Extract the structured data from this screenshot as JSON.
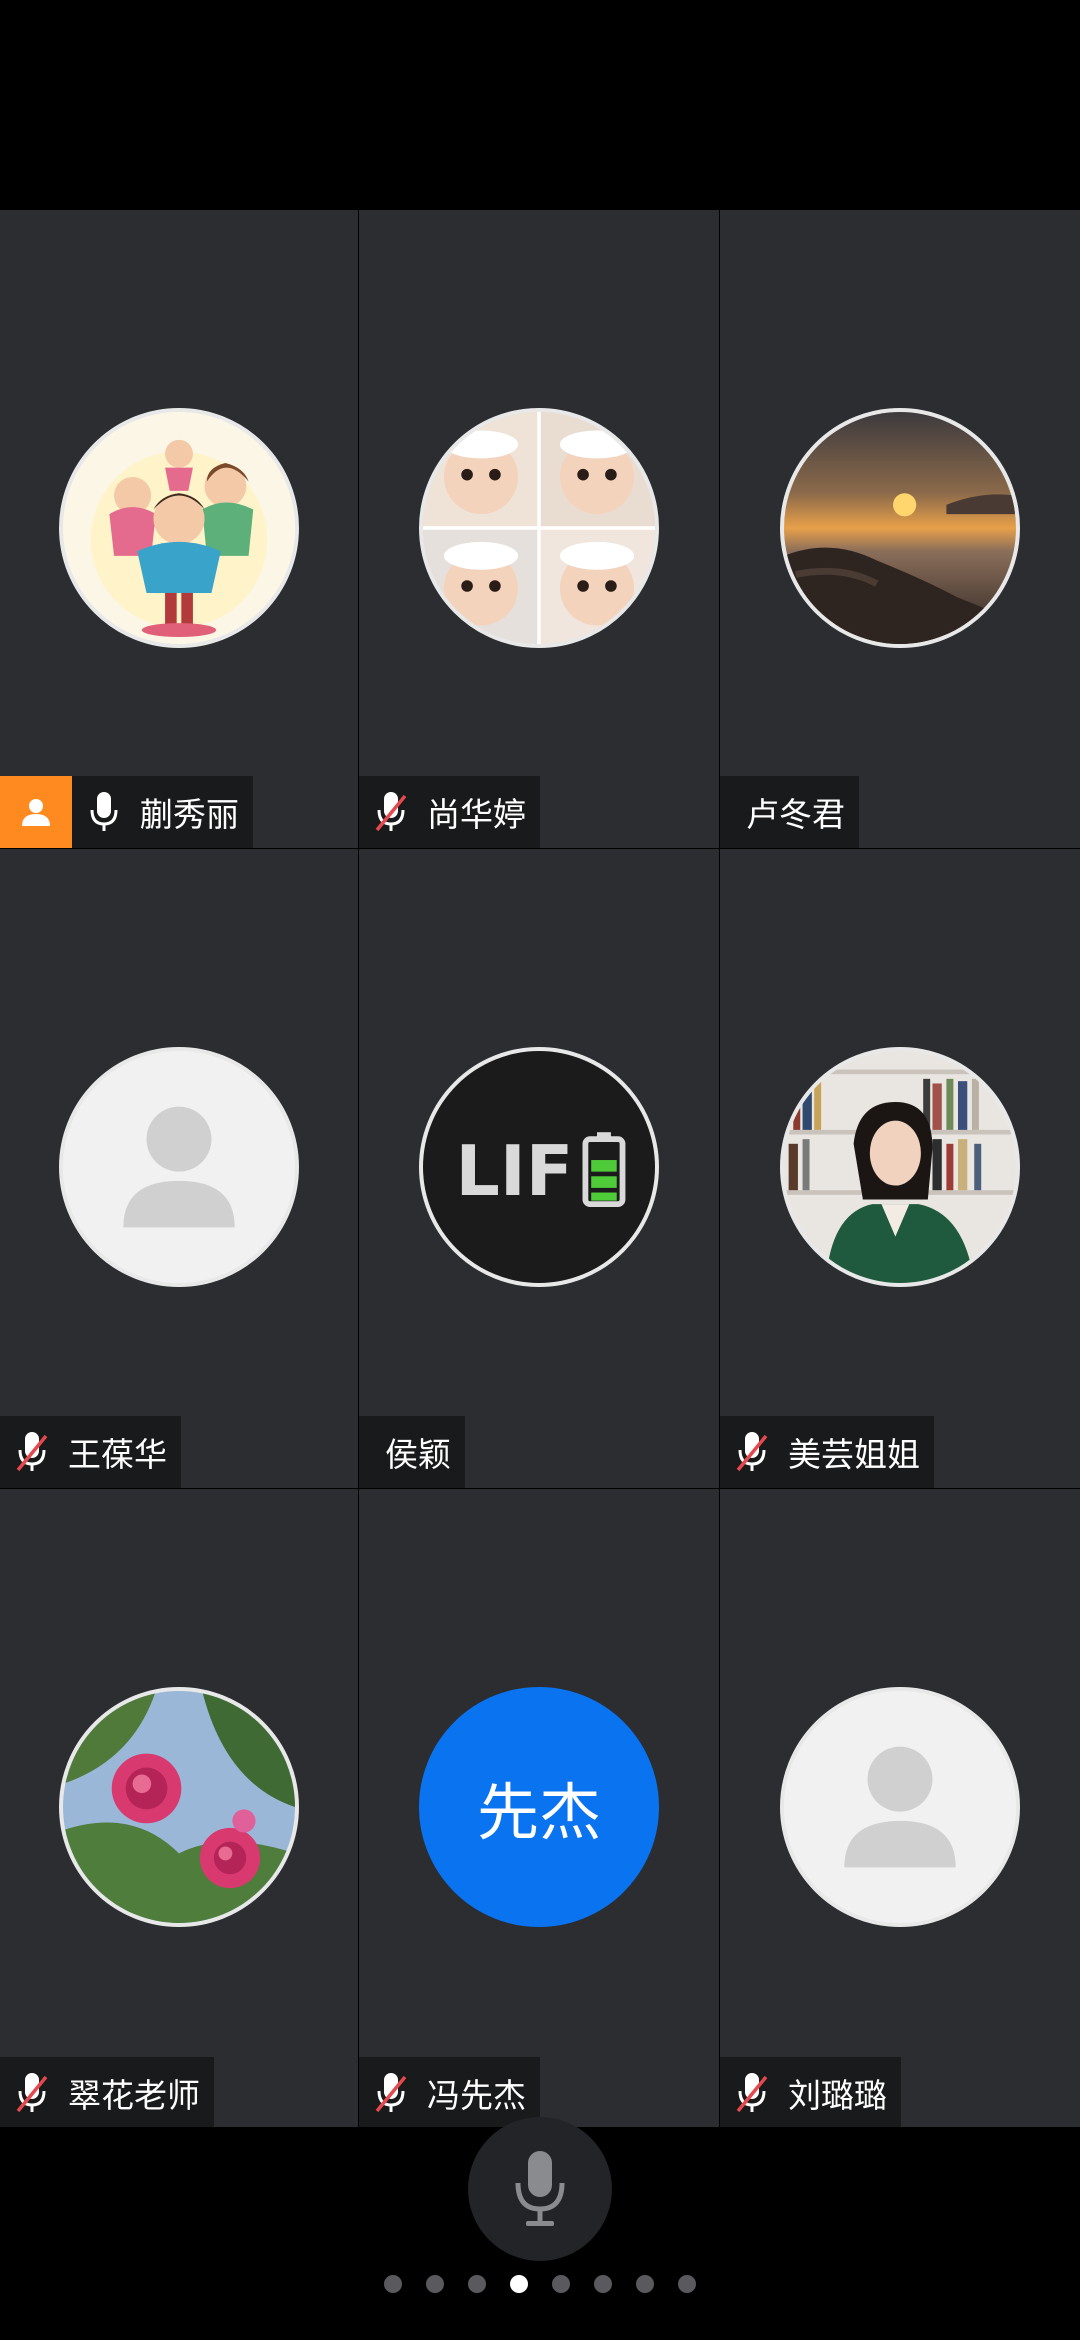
{
  "participants": [
    {
      "name": "蒯秀丽",
      "mic": "on",
      "host": true,
      "avatar": "family-cartoon"
    },
    {
      "name": "尚华婷",
      "mic": "muted",
      "host": false,
      "avatar": "baby-photo-collage"
    },
    {
      "name": "卢冬君",
      "mic": "none",
      "host": false,
      "avatar": "sunset-sea"
    },
    {
      "name": "王葆华",
      "mic": "muted",
      "host": false,
      "avatar": "default-person"
    },
    {
      "name": "侯颖",
      "mic": "none",
      "host": false,
      "avatar": "life-battery"
    },
    {
      "name": "美芸姐姐",
      "mic": "muted",
      "host": false,
      "avatar": "woman-bookshelf"
    },
    {
      "name": "翠花老师",
      "mic": "muted",
      "host": false,
      "avatar": "pink-roses"
    },
    {
      "name": "冯先杰",
      "mic": "muted",
      "host": false,
      "avatar": "initials",
      "initials": "先杰"
    },
    {
      "name": "刘璐璐",
      "mic": "muted",
      "host": false,
      "avatar": "default-person"
    }
  ],
  "avatar_text": {
    "life": "LIF"
  },
  "pagination": {
    "pages": 8,
    "current": 4
  },
  "colors": {
    "tile_bg": "#2b2d31",
    "host_badge": "#ff8a1f",
    "initials_avatar": "#0a73f0",
    "muted_slash": "#e5484d"
  },
  "icons": {
    "mic": "microphone-icon",
    "muted": "microphone-muted-icon",
    "host": "host-person-icon"
  }
}
